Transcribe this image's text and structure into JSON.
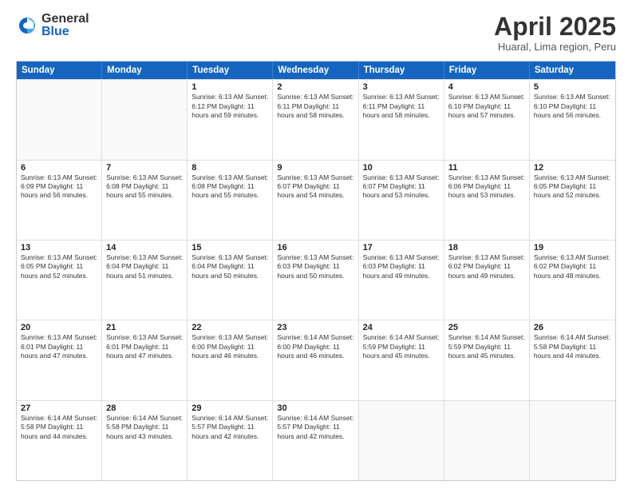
{
  "logo": {
    "general": "General",
    "blue": "Blue"
  },
  "title": "April 2025",
  "subtitle": "Huaral, Lima region, Peru",
  "header": {
    "days": [
      "Sunday",
      "Monday",
      "Tuesday",
      "Wednesday",
      "Thursday",
      "Friday",
      "Saturday"
    ]
  },
  "weeks": [
    [
      {
        "day": "",
        "info": ""
      },
      {
        "day": "",
        "info": ""
      },
      {
        "day": "1",
        "info": "Sunrise: 6:13 AM\nSunset: 6:12 PM\nDaylight: 11 hours and 59 minutes."
      },
      {
        "day": "2",
        "info": "Sunrise: 6:13 AM\nSunset: 6:11 PM\nDaylight: 11 hours and 58 minutes."
      },
      {
        "day": "3",
        "info": "Sunrise: 6:13 AM\nSunset: 6:11 PM\nDaylight: 11 hours and 58 minutes."
      },
      {
        "day": "4",
        "info": "Sunrise: 6:13 AM\nSunset: 6:10 PM\nDaylight: 11 hours and 57 minutes."
      },
      {
        "day": "5",
        "info": "Sunrise: 6:13 AM\nSunset: 6:10 PM\nDaylight: 11 hours and 56 minutes."
      }
    ],
    [
      {
        "day": "6",
        "info": "Sunrise: 6:13 AM\nSunset: 6:09 PM\nDaylight: 11 hours and 56 minutes."
      },
      {
        "day": "7",
        "info": "Sunrise: 6:13 AM\nSunset: 6:08 PM\nDaylight: 11 hours and 55 minutes."
      },
      {
        "day": "8",
        "info": "Sunrise: 6:13 AM\nSunset: 6:08 PM\nDaylight: 11 hours and 55 minutes."
      },
      {
        "day": "9",
        "info": "Sunrise: 6:13 AM\nSunset: 6:07 PM\nDaylight: 11 hours and 54 minutes."
      },
      {
        "day": "10",
        "info": "Sunrise: 6:13 AM\nSunset: 6:07 PM\nDaylight: 11 hours and 53 minutes."
      },
      {
        "day": "11",
        "info": "Sunrise: 6:13 AM\nSunset: 6:06 PM\nDaylight: 11 hours and 53 minutes."
      },
      {
        "day": "12",
        "info": "Sunrise: 6:13 AM\nSunset: 6:05 PM\nDaylight: 11 hours and 52 minutes."
      }
    ],
    [
      {
        "day": "13",
        "info": "Sunrise: 6:13 AM\nSunset: 6:05 PM\nDaylight: 11 hours and 52 minutes."
      },
      {
        "day": "14",
        "info": "Sunrise: 6:13 AM\nSunset: 6:04 PM\nDaylight: 11 hours and 51 minutes."
      },
      {
        "day": "15",
        "info": "Sunrise: 6:13 AM\nSunset: 6:04 PM\nDaylight: 11 hours and 50 minutes."
      },
      {
        "day": "16",
        "info": "Sunrise: 6:13 AM\nSunset: 6:03 PM\nDaylight: 11 hours and 50 minutes."
      },
      {
        "day": "17",
        "info": "Sunrise: 6:13 AM\nSunset: 6:03 PM\nDaylight: 11 hours and 49 minutes."
      },
      {
        "day": "18",
        "info": "Sunrise: 6:13 AM\nSunset: 6:02 PM\nDaylight: 11 hours and 49 minutes."
      },
      {
        "day": "19",
        "info": "Sunrise: 6:13 AM\nSunset: 6:02 PM\nDaylight: 11 hours and 48 minutes."
      }
    ],
    [
      {
        "day": "20",
        "info": "Sunrise: 6:13 AM\nSunset: 6:01 PM\nDaylight: 11 hours and 47 minutes."
      },
      {
        "day": "21",
        "info": "Sunrise: 6:13 AM\nSunset: 6:01 PM\nDaylight: 11 hours and 47 minutes."
      },
      {
        "day": "22",
        "info": "Sunrise: 6:13 AM\nSunset: 6:00 PM\nDaylight: 11 hours and 46 minutes."
      },
      {
        "day": "23",
        "info": "Sunrise: 6:14 AM\nSunset: 6:00 PM\nDaylight: 11 hours and 46 minutes."
      },
      {
        "day": "24",
        "info": "Sunrise: 6:14 AM\nSunset: 5:59 PM\nDaylight: 11 hours and 45 minutes."
      },
      {
        "day": "25",
        "info": "Sunrise: 6:14 AM\nSunset: 5:59 PM\nDaylight: 11 hours and 45 minutes."
      },
      {
        "day": "26",
        "info": "Sunrise: 6:14 AM\nSunset: 5:58 PM\nDaylight: 11 hours and 44 minutes."
      }
    ],
    [
      {
        "day": "27",
        "info": "Sunrise: 6:14 AM\nSunset: 5:58 PM\nDaylight: 11 hours and 44 minutes."
      },
      {
        "day": "28",
        "info": "Sunrise: 6:14 AM\nSunset: 5:58 PM\nDaylight: 11 hours and 43 minutes."
      },
      {
        "day": "29",
        "info": "Sunrise: 6:14 AM\nSunset: 5:57 PM\nDaylight: 11 hours and 42 minutes."
      },
      {
        "day": "30",
        "info": "Sunrise: 6:14 AM\nSunset: 5:57 PM\nDaylight: 11 hours and 42 minutes."
      },
      {
        "day": "",
        "info": ""
      },
      {
        "day": "",
        "info": ""
      },
      {
        "day": "",
        "info": ""
      }
    ]
  ]
}
